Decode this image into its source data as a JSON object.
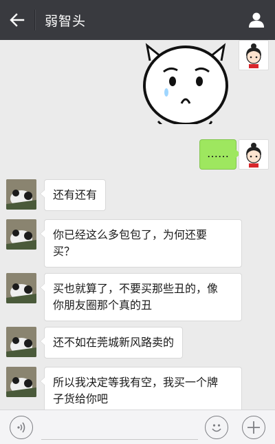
{
  "header": {
    "title": "弱智头",
    "back_icon": "arrow-left-icon",
    "profile_icon": "person-icon"
  },
  "messages": [
    {
      "side": "right",
      "type": "sticker",
      "sticker": "crying-cartoon-face"
    },
    {
      "side": "right",
      "type": "text",
      "text": "……"
    },
    {
      "side": "left",
      "type": "text",
      "text": "还有还有"
    },
    {
      "side": "left",
      "type": "text",
      "lines": [
        "你已经这么多包包了，为何还要",
        "买？"
      ]
    },
    {
      "side": "left",
      "type": "text",
      "lines": [
        "买也就算了，不要买那些丑的，像",
        "你朋友圈那个真的丑"
      ]
    },
    {
      "side": "left",
      "type": "text",
      "text": "还不如在莞城新风路卖的"
    },
    {
      "side": "left",
      "type": "text",
      "lines": [
        "所以我决定等我有空，我买一个牌",
        "子货给你吧"
      ]
    }
  ],
  "inputbar": {
    "voice_icon": "voice-icon",
    "emoji_icon": "emoji-icon",
    "plus_icon": "plus-icon"
  },
  "colors": {
    "header_bg": "#393a3f",
    "chat_bg": "#ebebeb",
    "bubble_me": "#9ee75f",
    "bubble_other": "#ffffff"
  }
}
